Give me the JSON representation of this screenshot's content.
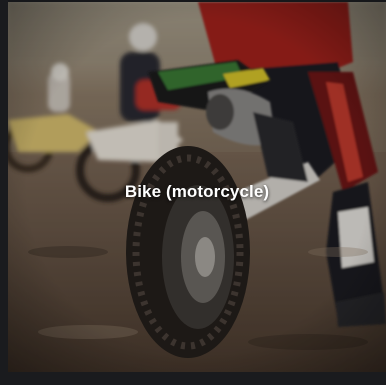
{
  "tile": {
    "label": "Bike (motorcycle)",
    "image_icon": "motocross-photo"
  },
  "colors": {
    "caption": "#ffffff",
    "background": "#16171a"
  }
}
